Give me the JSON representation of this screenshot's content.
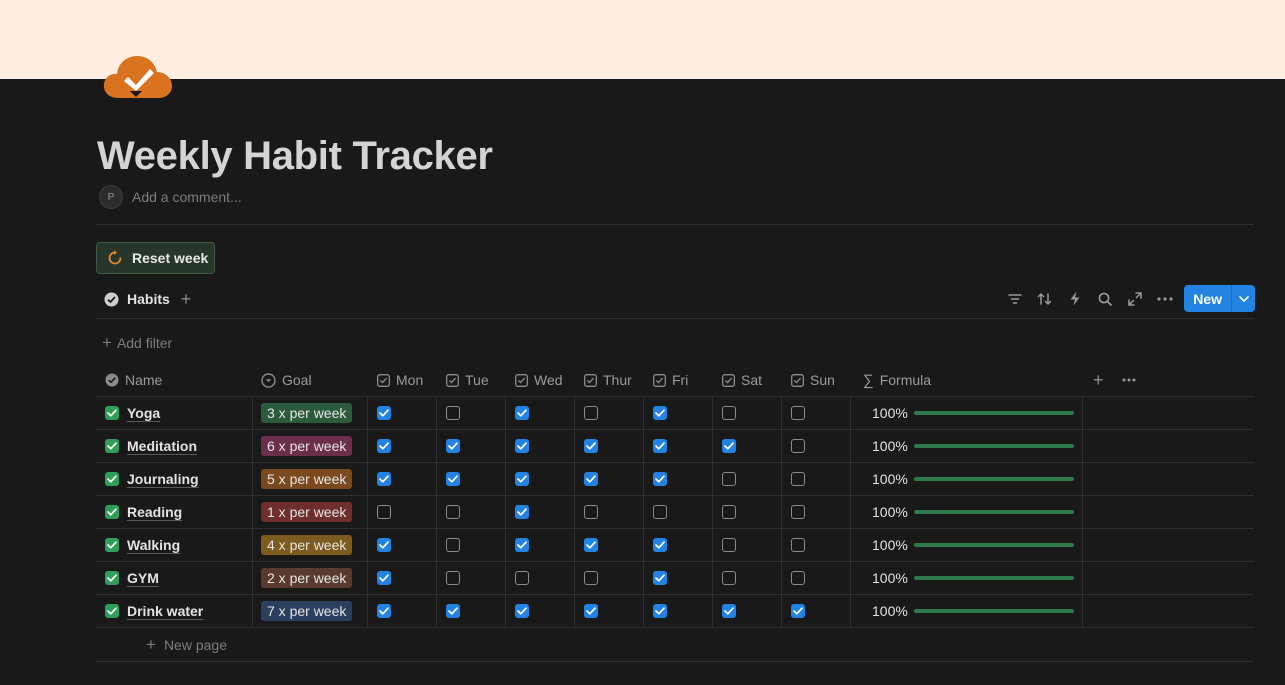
{
  "page": {
    "title": "Weekly Habit Tracker",
    "icon": "cloud-check-icon",
    "cover_color": "#fdeee1"
  },
  "comment": {
    "avatar_initial": "P",
    "placeholder": "Add a comment..."
  },
  "reset_button": {
    "label": "Reset week",
    "icon": "refresh-icon"
  },
  "view": {
    "tab_label": "Habits",
    "new_label": "New",
    "add_filter_label": "Add filter",
    "new_page_label": "New page"
  },
  "columns": {
    "name": "Name",
    "goal": "Goal",
    "days": [
      "Mon",
      "Tue",
      "Wed",
      "Thur",
      "Fri",
      "Sat",
      "Sun"
    ],
    "formula": "Formula"
  },
  "colors": {
    "accent": "#2383e2",
    "progress": "#2f7a4b",
    "done_check": "#2f9e58"
  },
  "rows": [
    {
      "name": "Yoga",
      "goal": "3 x per week",
      "goal_color": "#2b5a3c",
      "days": [
        true,
        false,
        true,
        false,
        true,
        false,
        false
      ],
      "formula": "100%",
      "progress": 1.0
    },
    {
      "name": "Meditation",
      "goal": "6 x per week",
      "goal_color": "#6b2f4b",
      "days": [
        true,
        true,
        true,
        true,
        true,
        true,
        false
      ],
      "formula": "100%",
      "progress": 1.0
    },
    {
      "name": "Journaling",
      "goal": "5 x per week",
      "goal_color": "#7a4a1e",
      "days": [
        true,
        true,
        true,
        true,
        true,
        false,
        false
      ],
      "formula": "100%",
      "progress": 1.0
    },
    {
      "name": "Reading",
      "goal": "1 x per week",
      "goal_color": "#6e2e2e",
      "days": [
        false,
        false,
        true,
        false,
        false,
        false,
        false
      ],
      "formula": "100%",
      "progress": 1.0
    },
    {
      "name": "Walking",
      "goal": "4 x per week",
      "goal_color": "#7d5a1d",
      "days": [
        true,
        false,
        true,
        true,
        true,
        false,
        false
      ],
      "formula": "100%",
      "progress": 1.0
    },
    {
      "name": "GYM",
      "goal": "2 x per week",
      "goal_color": "#5a3a2f",
      "days": [
        true,
        false,
        false,
        false,
        true,
        false,
        false
      ],
      "formula": "100%",
      "progress": 1.0
    },
    {
      "name": "Drink water",
      "goal": "7 x per week",
      "goal_color": "#2b3f5e",
      "days": [
        true,
        true,
        true,
        true,
        true,
        true,
        true
      ],
      "formula": "100%",
      "progress": 1.0
    }
  ]
}
